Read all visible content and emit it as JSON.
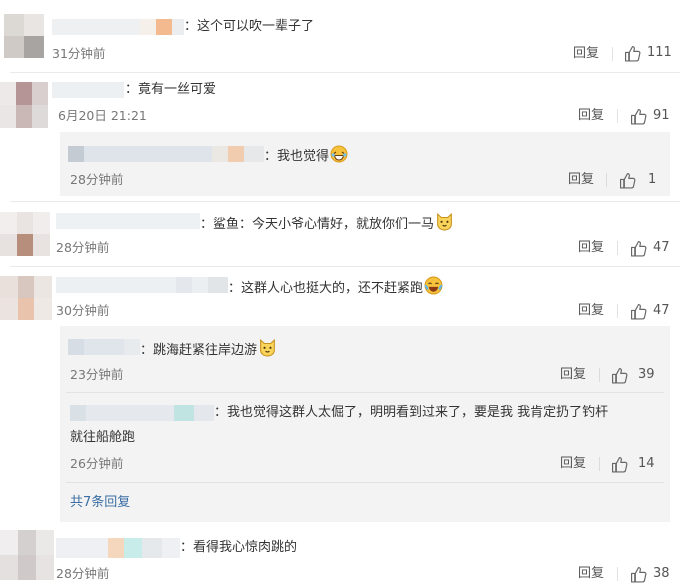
{
  "icons": {
    "like": "thumbs-up-icon",
    "laugh": "laughing-face-emoji",
    "cat": "cat-face-emoji",
    "cry_laugh": "tears-of-joy-emoji"
  },
  "colors": {
    "link": "#3a6ea5",
    "muted": "#777777",
    "reply_bg": "#f3f3f3"
  },
  "comments": [
    {
      "text": "：这个可以吹一辈子了",
      "time": "31分钟前",
      "reply": "回复",
      "likes": "111"
    },
    {
      "text": "：竟有一丝可爱",
      "time": "6月20日 21:21",
      "reply": "回复",
      "likes": "91",
      "replies": [
        {
          "text": "：我也觉得",
          "time": "28分钟前",
          "reply": "回复",
          "likes": "1"
        }
      ]
    },
    {
      "text": "：鲨鱼：今天小爷心情好，就放你们一马",
      "time": "28分钟前",
      "reply": "回复",
      "likes": "47"
    },
    {
      "text": "：这群人心也挺大的，还不赶紧跑",
      "time": "30分钟前",
      "reply": "回复",
      "likes": "47",
      "replies": [
        {
          "text": "：跳海赶紧往岸边游",
          "time": "23分钟前",
          "reply": "回复",
          "likes": "39"
        },
        {
          "text_line1": "：我也觉得这群人太倔了，明明看到过来了，要是我 我肯定扔了钓杆",
          "text_line2": "就往船舱跑",
          "time": "26分钟前",
          "reply": "回复",
          "likes": "14"
        }
      ],
      "more_replies": "共7条回复"
    },
    {
      "text": "：看得我心惊肉跳的",
      "time": "28分钟前",
      "reply": "回复",
      "likes": "38"
    }
  ]
}
